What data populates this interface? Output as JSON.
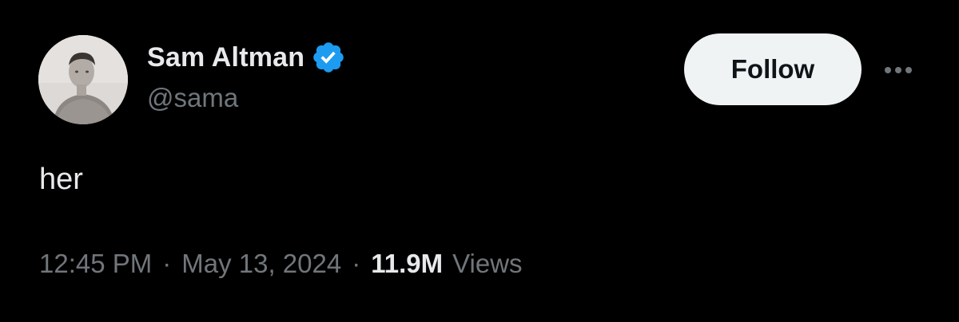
{
  "author": {
    "display_name": "Sam Altman",
    "handle": "@sama",
    "verified": true,
    "verified_color": "#1d9bf0"
  },
  "actions": {
    "follow_label": "Follow",
    "more_icon": "more-horizontal-icon"
  },
  "tweet": {
    "text": "her",
    "time": "12:45 PM",
    "date": "May 13, 2024",
    "separator": "·",
    "views_count": "11.9M",
    "views_label": "Views"
  },
  "colors": {
    "background": "#000000",
    "primary_text": "#e7e9ea",
    "secondary_text": "#71767b",
    "follow_bg": "#eff3f4",
    "follow_text": "#0f1419"
  }
}
